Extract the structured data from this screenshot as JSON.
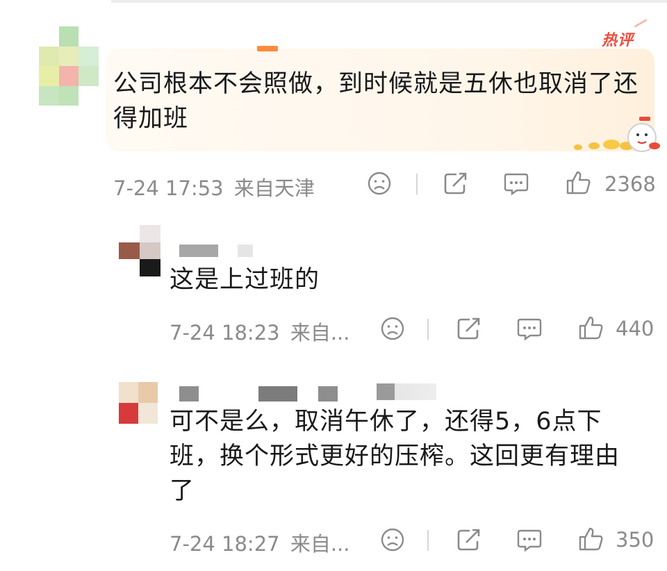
{
  "comments": [
    {
      "badge": "热评",
      "text": "公司根本不会照做，到时候就是五休也取消了还得加班",
      "time": "7-24 17:53",
      "location": "来自天津",
      "likes": "2368"
    },
    {
      "text": "这是上过班的",
      "time": "7-24 18:23",
      "location": "来自...",
      "likes": "440"
    },
    {
      "text": "可不是么，取消午休了，还得5，6点下班，换个形式更好的压榨。这回更有理由了",
      "time": "7-24 18:27",
      "location": "来自...",
      "likes": "350"
    }
  ],
  "icons": [
    "dislike-icon",
    "repost-icon",
    "comment-icon",
    "like-icon"
  ],
  "colors": {
    "badge": "#f04d3d",
    "card_bg": "#fff6ea",
    "meta_text": "#8a8a8a",
    "body_text": "#1a1a1a"
  }
}
